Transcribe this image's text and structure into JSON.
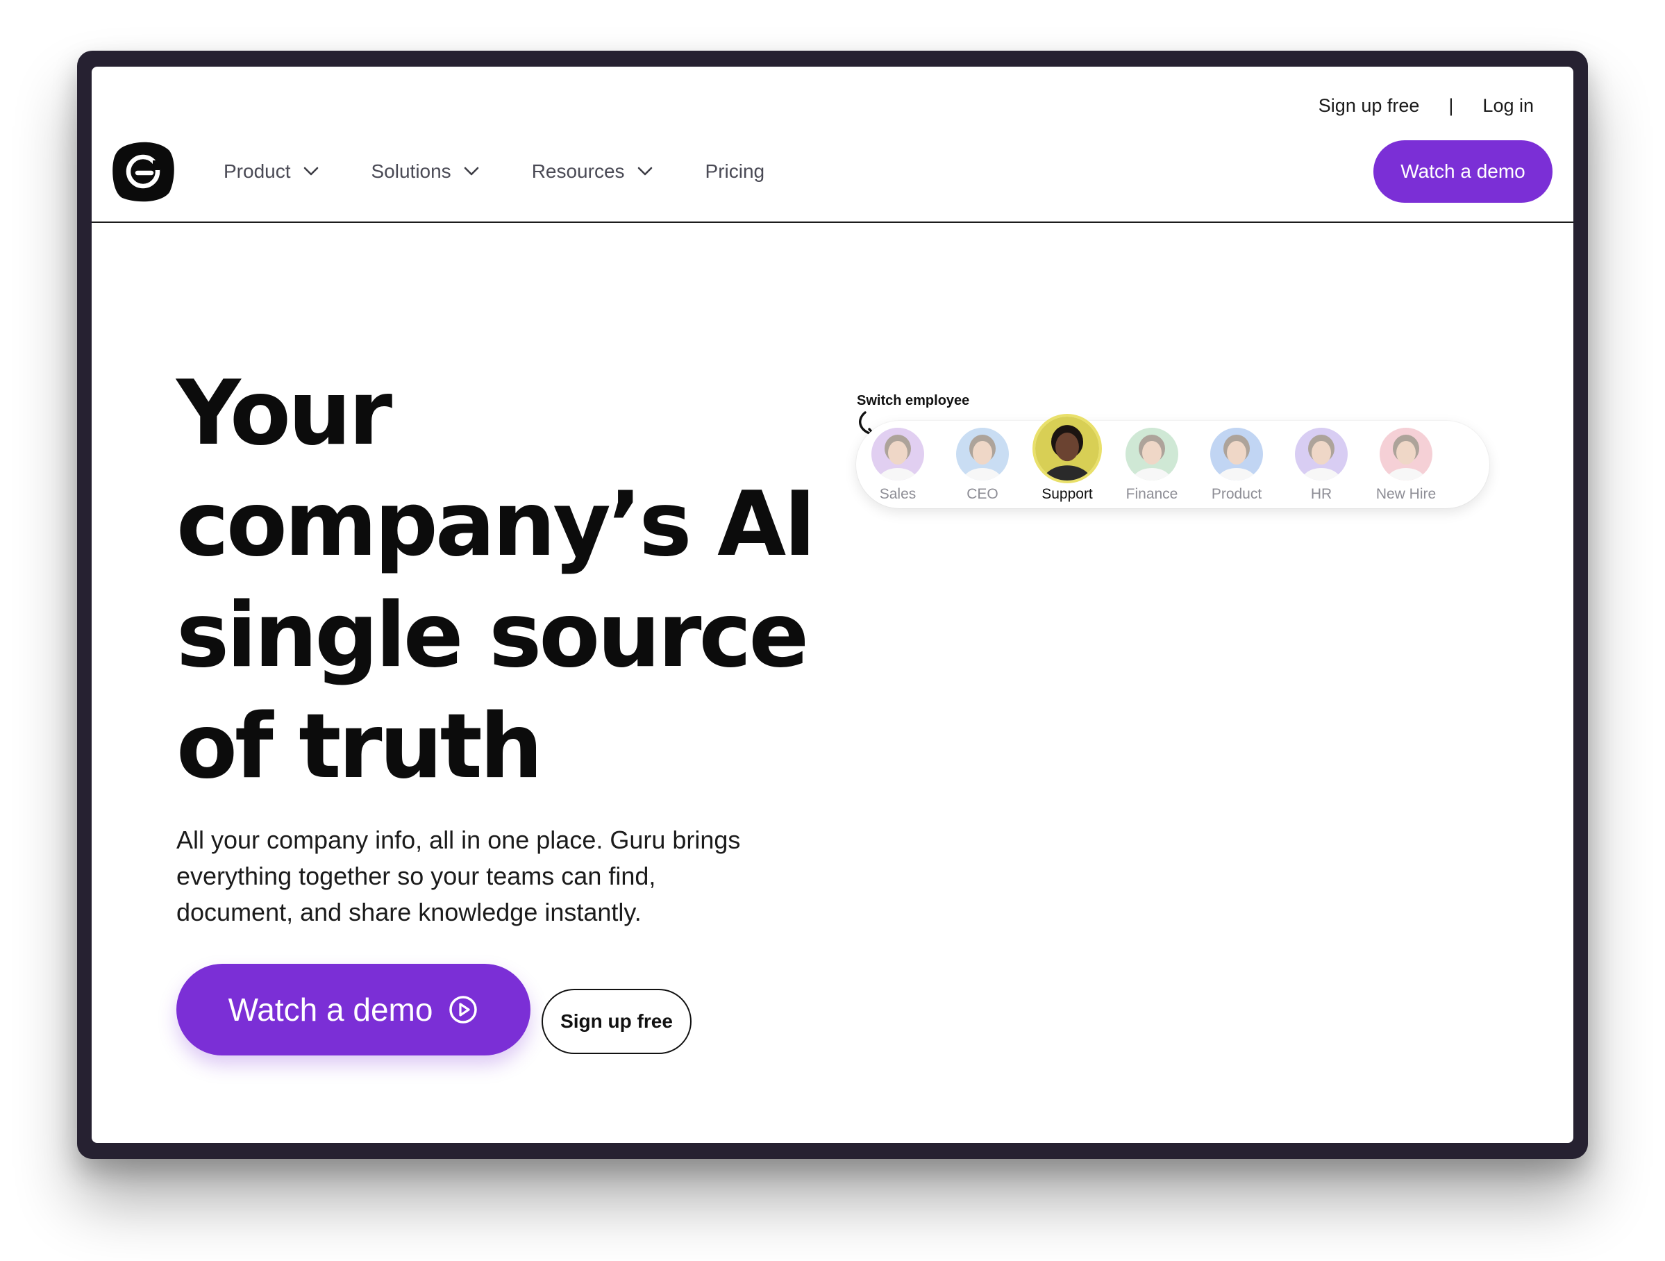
{
  "topbar": {
    "signup_label": "Sign up free",
    "separator": "|",
    "login_label": "Log in"
  },
  "nav": {
    "items": [
      {
        "label": "Product",
        "has_dropdown": true
      },
      {
        "label": "Solutions",
        "has_dropdown": true
      },
      {
        "label": "Resources",
        "has_dropdown": true
      },
      {
        "label": "Pricing",
        "has_dropdown": false
      }
    ],
    "cta_label": "Watch a demo"
  },
  "hero": {
    "title_lines": [
      "Your",
      "company’s AI",
      "single source",
      "of truth"
    ],
    "subtitle_lines": [
      "All your company info, all in one place. Guru brings",
      "everything together so your teams can find,",
      "document, and share knowledge instantly."
    ],
    "primary_cta": "Watch a demo",
    "secondary_cta": "Sign up free"
  },
  "switcher": {
    "label": "Switch employee",
    "employees": [
      {
        "name": "Sales",
        "active": false,
        "color": "#c9a9e6"
      },
      {
        "name": "CEO",
        "active": false,
        "color": "#9ec3ea"
      },
      {
        "name": "Support",
        "active": true,
        "color": "#d8cf55"
      },
      {
        "name": "Finance",
        "active": false,
        "color": "#a9d6b4"
      },
      {
        "name": "Product",
        "active": false,
        "color": "#8fb3ea"
      },
      {
        "name": "HR",
        "active": false,
        "color": "#b9a6ea"
      },
      {
        "name": "New Hire",
        "active": false,
        "color": "#eeaab6"
      }
    ]
  },
  "colors": {
    "accent": "#7b2fd6",
    "frame": "#262131",
    "text": "#0c0c0c"
  }
}
